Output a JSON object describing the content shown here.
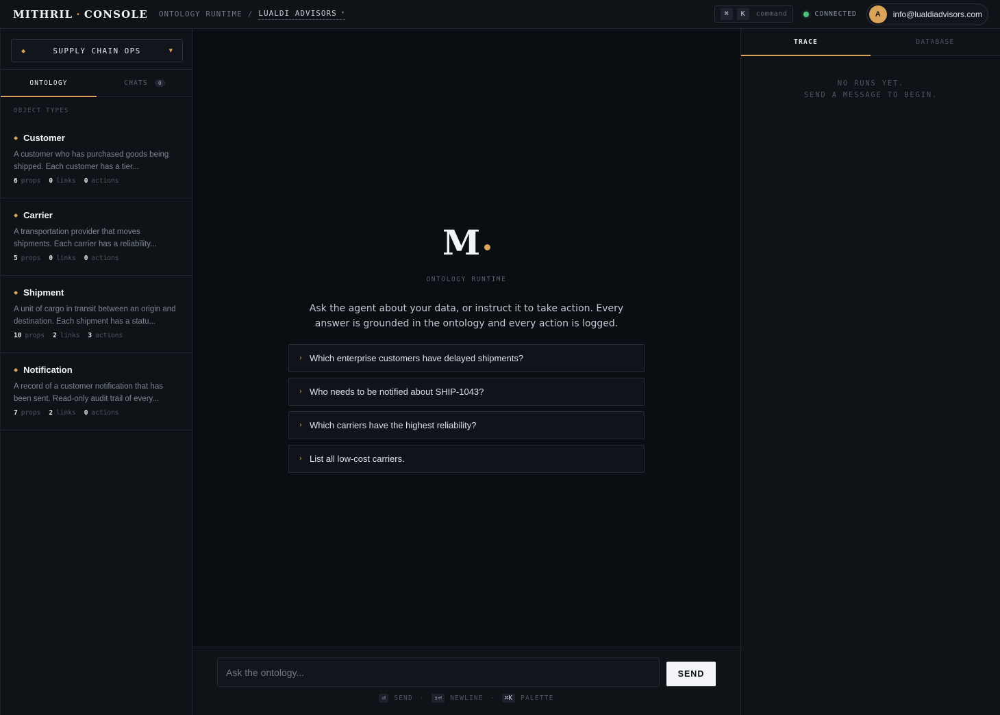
{
  "topbar": {
    "brand_left": "MITHRIL",
    "brand_sep": "·",
    "brand_right": "CONSOLE",
    "breadcrumb_root": "ONTOLOGY RUNTIME",
    "breadcrumb_sep": "/",
    "breadcrumb_org": "LUALDI ADVISORS",
    "cmd_key1": "⌘",
    "cmd_key2": "K",
    "cmd_label": "command",
    "status": "CONNECTED",
    "user_initial": "A",
    "user_email": "info@lualdiadvisors.com"
  },
  "sidebar": {
    "workspace": "SUPPLY CHAIN OPS",
    "tabs": [
      {
        "label": "ONTOLOGY",
        "active": true
      },
      {
        "label": "CHATS",
        "badge": "0",
        "active": false
      }
    ],
    "section_label": "OBJECT TYPES",
    "object_types": [
      {
        "name": "Customer",
        "description": "A customer who has purchased goods being shipped. Each customer has a tier...",
        "props": "6",
        "links": "0",
        "actions": "0"
      },
      {
        "name": "Carrier",
        "description": "A transportation provider that moves shipments. Each carrier has a reliability...",
        "props": "5",
        "links": "0",
        "actions": "0"
      },
      {
        "name": "Shipment",
        "description": "A unit of cargo in transit between an origin and destination. Each shipment has a statu...",
        "props": "10",
        "links": "2",
        "actions": "3"
      },
      {
        "name": "Notification",
        "description": "A record of a customer notification that has been sent. Read-only audit trail of every...",
        "props": "7",
        "links": "2",
        "actions": "0"
      }
    ],
    "stat_labels": {
      "props": "props",
      "links": "links",
      "actions": "actions"
    }
  },
  "center": {
    "logo_letter": "M",
    "subtitle": "ONTOLOGY RUNTIME",
    "lead": "Ask the agent about your data, or instruct it to take action. Every answer is grounded in the ontology and every action is logged.",
    "suggestions": [
      "Which enterprise customers have delayed shipments?",
      "Who needs to be notified about SHIP-1043?",
      "Which carriers have the highest reliability?",
      "List all low-cost carriers."
    ]
  },
  "composer": {
    "placeholder": "Ask the ontology...",
    "send_label": "SEND",
    "hints": [
      {
        "key": "⏎",
        "label": "SEND"
      },
      {
        "key": "⇧⏎",
        "label": "NEWLINE"
      },
      {
        "key": "⌘K",
        "label": "PALETTE"
      }
    ]
  },
  "right_panel": {
    "tabs": [
      {
        "label": "TRACE",
        "active": true
      },
      {
        "label": "DATABASE",
        "active": false
      }
    ],
    "empty_line1": "NO RUNS YET.",
    "empty_line2": "SEND A MESSAGE TO BEGIN."
  },
  "colors": {
    "accent": "#d9a45a",
    "status_ok": "#4fc07a",
    "background": "#0b0e13"
  }
}
